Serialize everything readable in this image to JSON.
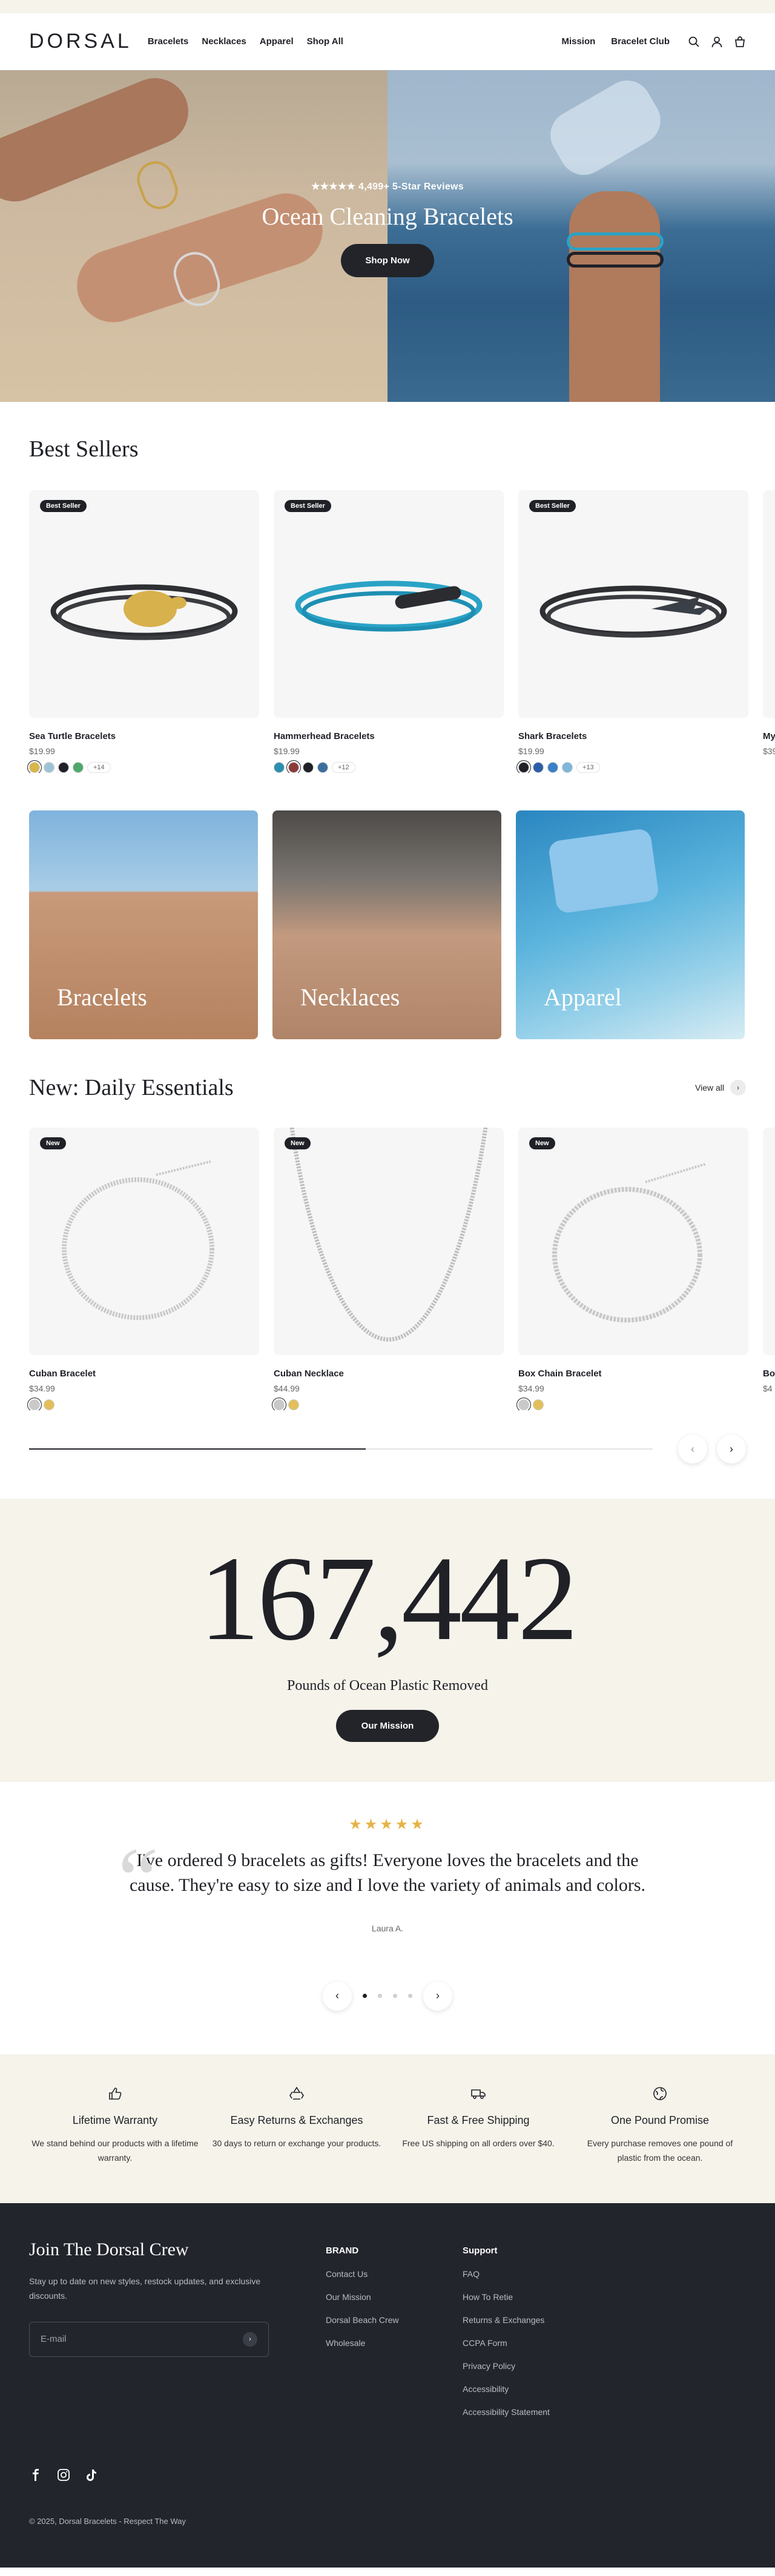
{
  "header": {
    "logo": "DORSAL",
    "nav": [
      "Bracelets",
      "Necklaces",
      "Apparel",
      "Shop All"
    ],
    "right_links": [
      "Mission",
      "Bracelet Club"
    ],
    "icons": [
      "search-icon",
      "account-icon",
      "cart-icon"
    ]
  },
  "hero": {
    "reviews": "★★★★★ 4,499+ 5-Star Reviews",
    "title": "Ocean Cleaning Bracelets",
    "button": "Shop Now"
  },
  "best_sellers": {
    "title": "Best Sellers",
    "products": [
      {
        "badge": "Best Seller",
        "name": "Sea Turtle Bracelets",
        "price": "$19.99",
        "swatch_colors": [
          "#d9b64a",
          "#9ec3d6",
          "#1f2127",
          "#4ea86b"
        ],
        "more": "+14"
      },
      {
        "badge": "Best Seller",
        "name": "Hammerhead Bracelets",
        "price": "$19.99",
        "swatch_colors": [
          "#2b8fb0",
          "#8b3a3a",
          "#1f2127",
          "#3b6e9c"
        ],
        "more": "+12"
      },
      {
        "badge": "Best Seller",
        "name": "Shark Bracelets",
        "price": "$19.99",
        "swatch_colors": [
          "#1f2127",
          "#2c5ea8",
          "#3a7fc7",
          "#7fb6d9"
        ],
        "more": "+13"
      },
      {
        "badge": "",
        "name": "My",
        "price": "$39",
        "swatch_colors": [],
        "more": ""
      }
    ]
  },
  "categories": [
    {
      "label": "Bracelets"
    },
    {
      "label": "Necklaces"
    },
    {
      "label": "Apparel"
    }
  ],
  "essentials": {
    "title": "New: Daily Essentials",
    "view_all": "View all",
    "progress": 0.54,
    "products": [
      {
        "badge": "New",
        "name": "Cuban Bracelet",
        "price": "$34.99",
        "swatch_colors": [
          "#c9c9c9",
          "#e2bf5a"
        ]
      },
      {
        "badge": "New",
        "name": "Cuban Necklace",
        "price": "$44.99",
        "swatch_colors": [
          "#c9c9c9",
          "#e2bf5a"
        ]
      },
      {
        "badge": "New",
        "name": "Box Chain Bracelet",
        "price": "$34.99",
        "swatch_colors": [
          "#c9c9c9",
          "#e2bf5a"
        ]
      },
      {
        "badge": "",
        "name": "Box",
        "price": "$4",
        "swatch_colors": []
      }
    ]
  },
  "impact": {
    "number": "167,442",
    "subtitle": "Pounds of Ocean Plastic Removed",
    "button": "Our Mission"
  },
  "testimonial": {
    "stars": "★★★★★",
    "quote": "I've ordered 9 bracelets as gifts! Everyone loves the bracelets and the cause. They're easy to size and I love the variety of animals and colors.",
    "author": "Laura A.",
    "dots": 4,
    "active": 0
  },
  "benefits": [
    {
      "icon": "thumbs-up-icon",
      "title": "Lifetime Warranty",
      "text": "We stand behind our products with a lifetime warranty."
    },
    {
      "icon": "recycle-icon",
      "title": "Easy Returns & Exchanges",
      "text": "30 days to return or exchange your products."
    },
    {
      "icon": "truck-icon",
      "title": "Fast & Free Shipping",
      "text": "Free US shipping on all orders over $40."
    },
    {
      "icon": "globe-icon",
      "title": "One Pound Promise",
      "text": "Every purchase removes one pound of plastic from the ocean."
    }
  ],
  "footer": {
    "join_title": "Join The Dorsal Crew",
    "join_text": "Stay up to date on new styles, restock updates, and exclusive discounts.",
    "email_placeholder": "E-mail",
    "brand_title": "BRAND",
    "brand_links": [
      "Contact Us",
      "Our Mission",
      "Dorsal Beach Crew",
      "Wholesale"
    ],
    "support_title": "Support",
    "support_links": [
      "FAQ",
      "How To Retie",
      "Returns & Exchanges",
      "CCPA Form",
      "Privacy Policy",
      "Accessibility",
      "Accessibility Statement"
    ],
    "socials": [
      "facebook-icon",
      "instagram-icon",
      "tiktok-icon"
    ],
    "copyright": "© 2025, Dorsal Bracelets - Respect The Way"
  }
}
